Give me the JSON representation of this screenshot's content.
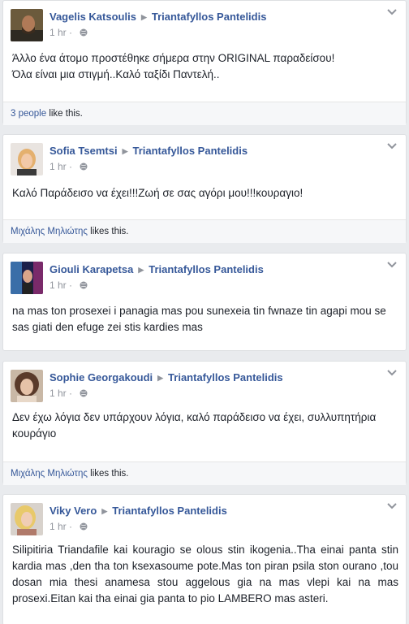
{
  "posts": [
    {
      "author": "Vagelis Katsoulis",
      "target": "Triantafyllos Pantelidis",
      "time": "1 hr",
      "text": "Άλλο ένα άτομο προστέθηκε σήμερα στην ORIGINAL παραδείσου!\nΌλα είναι μια στιγμή..Καλό ταξίδι Παντελή..",
      "likes_who": "3 people",
      "likes_suffix": " like this."
    },
    {
      "author": "Sofia Tsemtsi",
      "target": "Triantafyllos Pantelidis",
      "time": "1 hr",
      "text": "Καλό Παράδεισο να έχει!!!Ζωή σε σας αγόρι μου!!!κουραγιο!",
      "likes_who": "Μιχάλης Μηλιώτης",
      "likes_suffix": " likes this."
    },
    {
      "author": "Giouli Karapetsa",
      "target": "Triantafyllos Pantelidis",
      "time": "1 hr",
      "text": "na mas ton prosexei i panagia mas pou sunexeia tin fwnaze tin agapi mou se sas giati den efuge zei stis kardies mas"
    },
    {
      "author": "Sophie Georgakoudi",
      "target": "Triantafyllos Pantelidis",
      "time": "1 hr",
      "text": "Δεν έχω λόγια δεν υπάρχουν λόγια, καλό παράδεισο να έχει, συλλυπητήρια κουράγιο",
      "likes_who": "Μιχάλης Μηλιώτης",
      "likes_suffix": " likes this."
    },
    {
      "author": "Viky Vero",
      "target": "Triantafyllos Pantelidis",
      "time": "1 hr",
      "text": "Silipitiria Triandafile kai kouragio se olous stin ikogenia..Tha einai panta stin kardia mas ,den tha ton ksexasoume pote.Mas ton piran psila ston ourano ,tou dosan mia thesi anamesa stou aggelous gia na mas vlepi kai na mas prosexi.Eitan kai tha einai gia panta to pio LAMBERO mas asteri."
    }
  ]
}
